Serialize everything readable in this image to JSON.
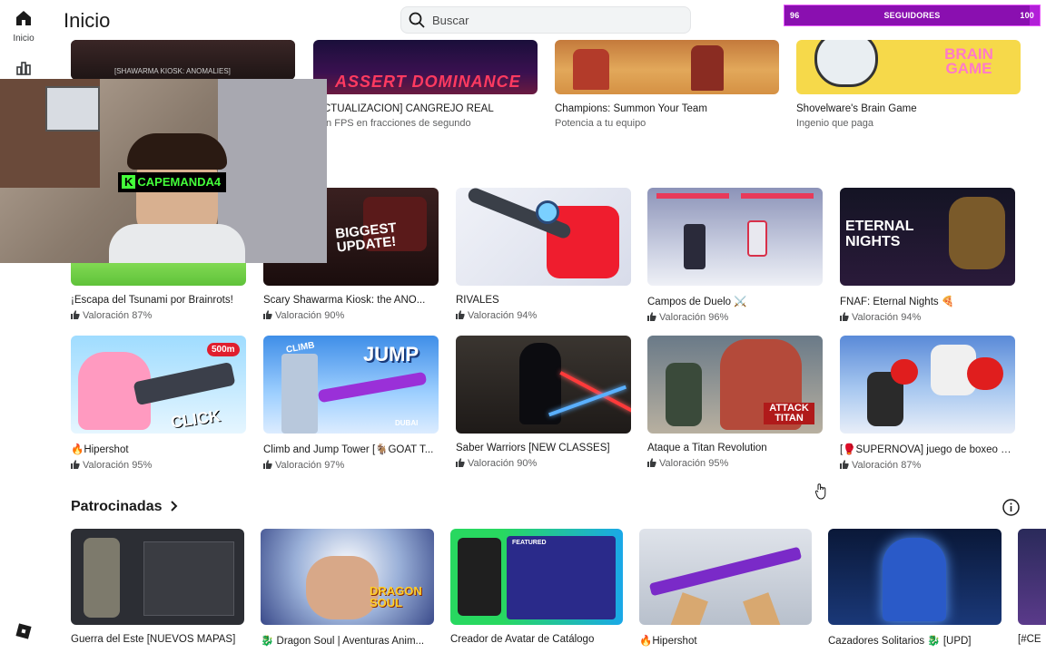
{
  "rail": {
    "home_label": "Inicio"
  },
  "header": {
    "title": "Inicio",
    "search_placeholder": "Buscar"
  },
  "followers": {
    "min": "96",
    "label": "SEGUIDORES",
    "max": "100",
    "progress": 0.96
  },
  "webcam": {
    "tag": "CAPEMANDA",
    "tag_suffix": "4"
  },
  "top_row": [
    {
      "title": "",
      "subtitle": "",
      "thumb_text": "[SHAWARMA KIOSK: ANOMALIES]"
    },
    {
      "title": "[ACTUALIZACIÓN] CANGREJO REAL",
      "subtitle": "ción FPS en fracciones de segundo",
      "thumb_text": "ASSERT DOMINANCE"
    },
    {
      "title": "Champions: Summon Your Team",
      "subtitle": "Potencia a tu equipo",
      "thumb_text": ""
    },
    {
      "title": "Shovelware's Brain Game",
      "subtitle": "Ingenio que paga",
      "thumb_text": "BRAIN GAME"
    }
  ],
  "row1": [
    {
      "title": "¡Escapa del Tsunami por Brainrots!",
      "rating": "Valoración 87%",
      "thumb_text": ""
    },
    {
      "title": "Scary Shawarma Kiosk: the ANO...",
      "rating": "Valoración 90%",
      "thumb_text": "BIGGEST UPDATE!"
    },
    {
      "title": "RIVALES",
      "rating": "Valoración 94%",
      "thumb_text": ""
    },
    {
      "title": "Campos de Duelo ⚔️",
      "rating": "Valoración 96%",
      "thumb_text": ""
    },
    {
      "title": "FNAF: Eternal Nights 🍕",
      "rating": "Valoración 94%",
      "thumb_text": "ETERNAL NIGHTS"
    }
  ],
  "row2": [
    {
      "title": "🔥Hipershot",
      "rating": "Valoración 95%",
      "thumb_text": "CLICK",
      "badge": "500m"
    },
    {
      "title": "Climb and Jump Tower [🐐GOAT T...",
      "rating": "Valoración 97%",
      "thumb_text": "JUMP",
      "thumb_text2": "CLIMB",
      "badge": "DUBAI"
    },
    {
      "title": "Saber Warriors [NEW CLASSES]",
      "rating": "Valoración 90%",
      "thumb_text": ""
    },
    {
      "title": "Ataque a Titan Revolution",
      "rating": "Valoración 95%",
      "thumb_text": "ATTACK TITAN"
    },
    {
      "title": "[🥊SUPERNOVA] juego de boxeo si...",
      "rating": "Valoración 87%",
      "thumb_text": ""
    }
  ],
  "sponsored": {
    "title": "Patrocinadas",
    "items": [
      {
        "title": "Guerra del Este [NUEVOS MAPAS]"
      },
      {
        "title": "🐉 Dragon Soul | Aventuras Anim...",
        "thumb_text": "DRAGON SOUL"
      },
      {
        "title": "Creador de Avatar de Catálogo",
        "thumb_text": "FEATURED"
      },
      {
        "title": "🔥Hipershot"
      },
      {
        "title": "Cazadores Solitarios 🐉 [UPD]"
      },
      {
        "title": "[#CE"
      }
    ]
  },
  "colors": {
    "accent": "#b21fd8",
    "webcam_tag": "#44ff3a"
  }
}
